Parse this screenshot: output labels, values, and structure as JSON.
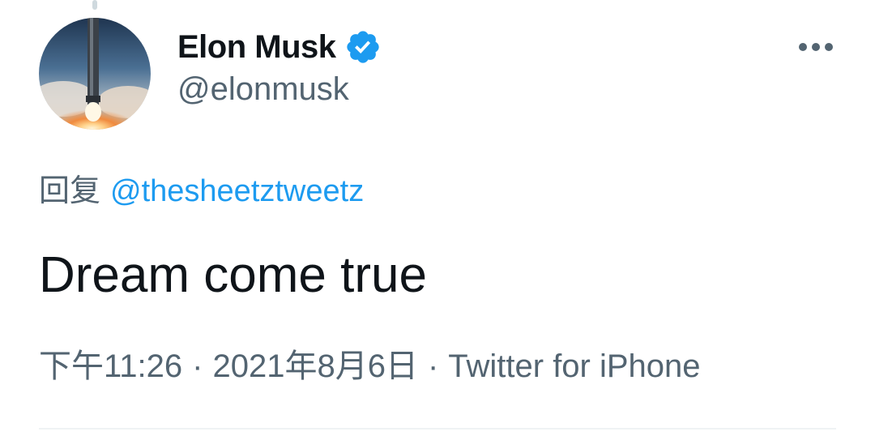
{
  "tweet": {
    "author": {
      "display_name": "Elon Musk",
      "handle": "@elonmusk",
      "verified": true,
      "avatar_icon": "rocket-launch-avatar"
    },
    "more_icon": "more-horizontal-icon",
    "reply": {
      "prefix": "回复",
      "mention": "@thesheetztweetz"
    },
    "text": "Dream come true",
    "meta": {
      "time": "下午11:26",
      "separator": "·",
      "date": "2021年8月6日",
      "source": "Twitter for iPhone"
    }
  },
  "colors": {
    "accent": "#1d9bf0",
    "text_primary": "#0f1419",
    "text_secondary": "#536471",
    "divider": "#eff3f4"
  }
}
